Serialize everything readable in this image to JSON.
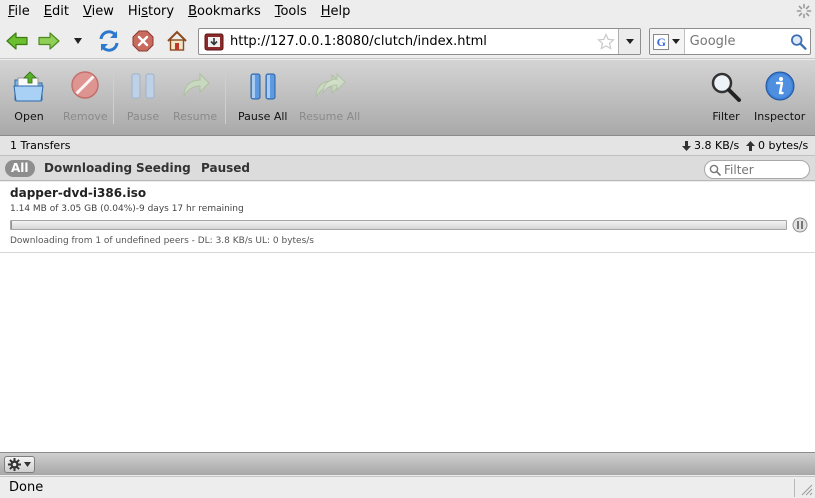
{
  "browser": {
    "menu": [
      {
        "pre": "",
        "ul": "F",
        "post": "ile"
      },
      {
        "pre": "",
        "ul": "E",
        "post": "dit"
      },
      {
        "pre": "",
        "ul": "V",
        "post": "iew"
      },
      {
        "pre": "Hi",
        "ul": "s",
        "post": "tory"
      },
      {
        "pre": "",
        "ul": "B",
        "post": "ookmarks"
      },
      {
        "pre": "",
        "ul": "T",
        "post": "ools"
      },
      {
        "pre": "",
        "ul": "H",
        "post": "elp"
      }
    ],
    "url": "http://127.0.0.1:8080/clutch/index.html",
    "search_placeholder": "Google",
    "status": "Done"
  },
  "clutch": {
    "toolbar": {
      "open": "Open",
      "remove": "Remove",
      "pause": "Pause",
      "resume": "Resume",
      "pause_all": "Pause All",
      "resume_all": "Resume All",
      "filter": "Filter",
      "inspector": "Inspector"
    },
    "stats": {
      "transfers": "1 Transfers",
      "download_speed": "3.8 KB/s",
      "upload_speed": "0 bytes/s"
    },
    "filters": {
      "all": "All",
      "downloading": "Downloading",
      "seeding": "Seeding",
      "paused": "Paused",
      "search_placeholder": "Filter"
    },
    "torrents": [
      {
        "name": "dapper-dvd-i386.iso",
        "progress_details": "1.14 MB of 3.05 GB (0.04%)-9 days 17 hr remaining",
        "percent_done": 0.04,
        "peer_details": "Downloading from 1 of undefined peers - DL: 3.8 KB/s UL: 0 bytes/s"
      }
    ]
  },
  "colors": {
    "progress_fill": "#6a9be0",
    "toolbar_icon_blue": "#3d7fd4",
    "remove_red": "#e05555"
  }
}
